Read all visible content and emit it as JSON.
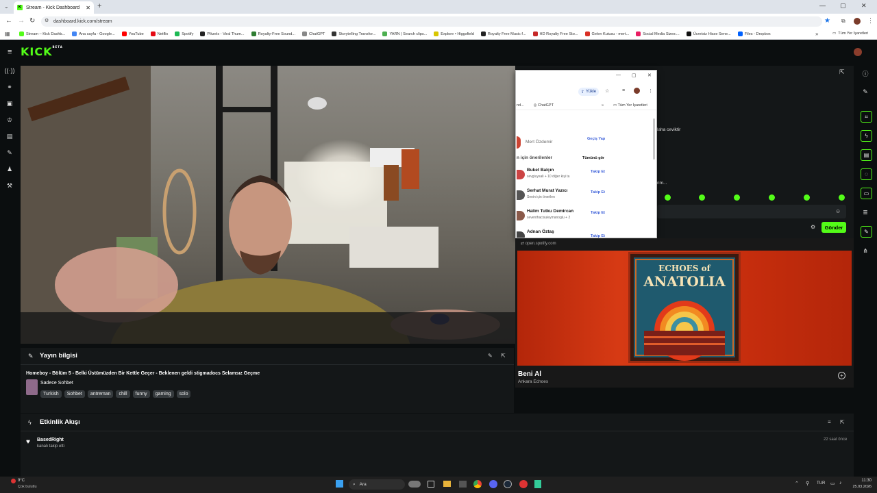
{
  "browser": {
    "tab_title": "Stream - Kick Dashboard",
    "url": "dashboard.kick.com/stream",
    "bookmarks": [
      "Stream – Kick Dashb...",
      "Ana sayfa - Google...",
      "YouTube",
      "Netflix",
      "Spotify",
      "Pikzels - Viral Thum...",
      "Royalty-Free Sound...",
      "ChatGPT",
      "Storytelling Transfor...",
      "YARN | Search clips...",
      "Explore • Higgsfield",
      "Royalty Free Music f...",
      "HD Royalty Free Sto...",
      "Gelen Kutusu - mert...",
      "Social Media Sizes:...",
      "Ücretsiz Hisse Sene...",
      "Files - Dropbox"
    ],
    "all_bookmarks": "Tüm Yer İşaretleri",
    "bookmark_colors": [
      "#53fc18",
      "#4285f4",
      "#ff0000",
      "#e50914",
      "#1db954",
      "#222",
      "#2e7d32",
      "#888",
      "#333",
      "#4caf50",
      "#d8c600",
      "#222",
      "#c62828",
      "#d93025",
      "#e91e63",
      "#111",
      "#0061fe"
    ]
  },
  "kick": {
    "logo": "KICK",
    "beta": "BETA"
  },
  "popup": {
    "upload": "Yükle",
    "bm_trunc": "nd...",
    "bm_chatgpt": "ChatGPT",
    "bm_all": "Tüm Yer İşaretleri",
    "profile_name": "Mert Özdemir",
    "switch": "Geçiş Yap",
    "suggested": "n için önerilenler",
    "see_all": "Tümünü gör",
    "suggestions": [
      {
        "name": "Buket Balçın",
        "sub": "sevgiuysali + 10 diğer kişi ta",
        "btn": "Takip Et"
      },
      {
        "name": "Serhat Murat Yazıcı",
        "sub": "Senin için önerilen",
        "btn": "Takip Et"
      },
      {
        "name": "Halim Tutku Demircan",
        "sub": "seventhacisuleymanoglu + 2",
        "btn": "Takip Et"
      },
      {
        "name": "Adnan Öztaş",
        "sub": "",
        "btn": "Takip Et"
      }
    ]
  },
  "chat": {
    "text1": "laha ceviktir",
    "text2": "rim...",
    "send": "Gönder"
  },
  "spotify": {
    "url": "open.spotify.com",
    "cover_line1": "ECHOES of",
    "cover_line2": "ANATOLIA",
    "track": "Beni Al",
    "artist": "Ankara Echoes"
  },
  "stream_info": {
    "title": "Yayın bilgisi",
    "stream_title": "Homeboy - Bölüm 5 - Belki Üstümüzden Bir Kettle Geçer - Beklenen geldi stigmadocs Selamsız Geçme",
    "category": "Sadece Sohbet",
    "tags": [
      "Turkish",
      "Sohbet",
      "antreman",
      "chill",
      "funny",
      "gaming",
      "solo"
    ]
  },
  "events": {
    "title": "Etkinlik Akışı",
    "user": "BasedRight",
    "action": "kanalı takip etti",
    "time": "22 saat önce"
  },
  "taskbar": {
    "temp": "9°C",
    "weather": "Çok bulutlu",
    "search": "Ara",
    "time": "11:30",
    "date": "25.03.2026",
    "lang": "TUR"
  }
}
